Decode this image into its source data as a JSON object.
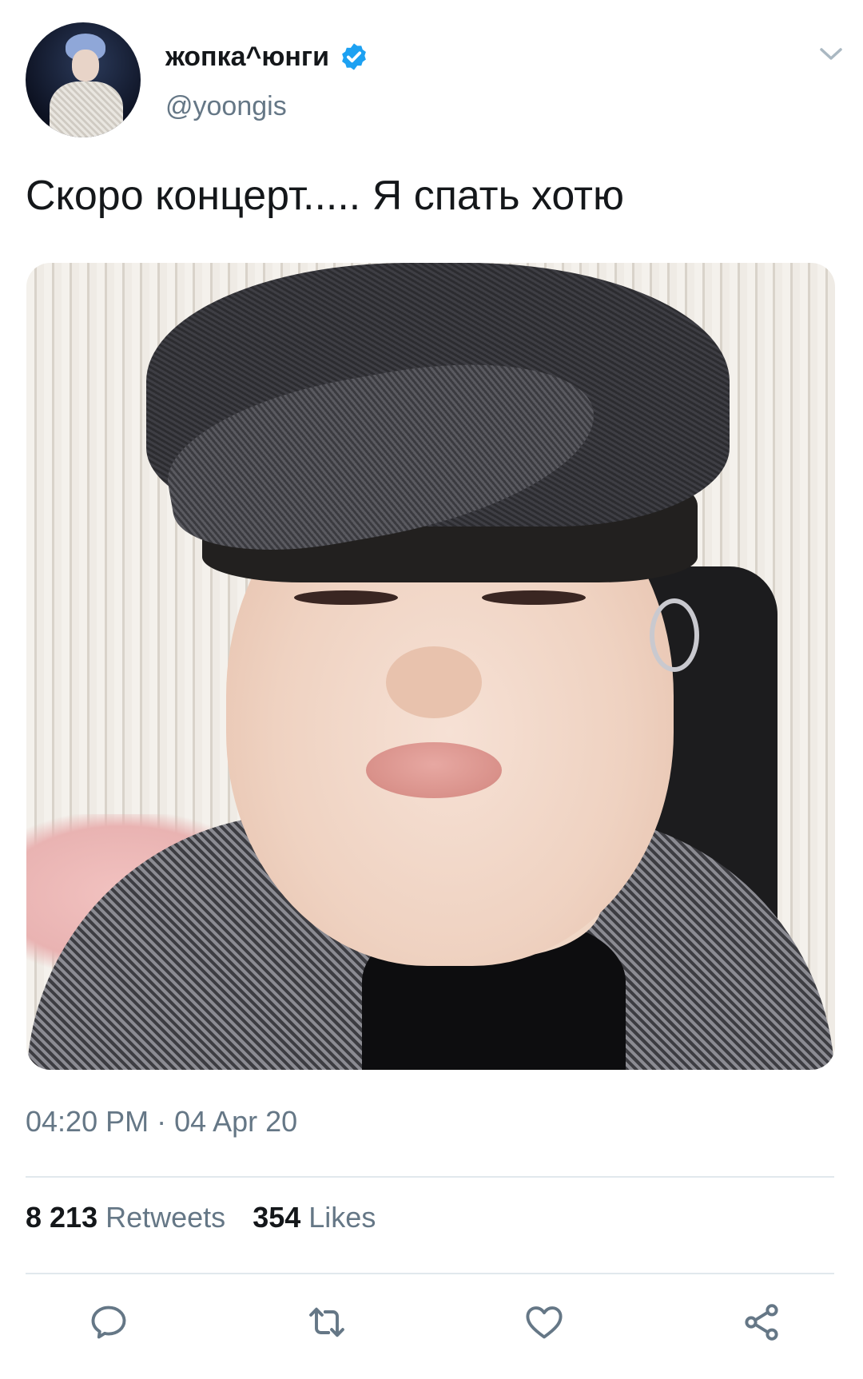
{
  "tweet": {
    "display_name": "жопка^юнги",
    "handle": "@yoongis",
    "verified": true,
    "text": "Скоро концерт..... Я спать хотю",
    "timestamp": "04:20 PM · 04 Apr 20",
    "stats": {
      "retweets_count": "8 213",
      "retweets_label": "Retweets",
      "likes_count": "354",
      "likes_label": "Likes"
    },
    "actions": [
      "reply-icon",
      "retweet-icon",
      "like-icon",
      "share-icon"
    ],
    "colors": {
      "verified": "#1da1f2",
      "secondary_text": "#657786",
      "primary_text": "#14171a",
      "divider": "#e1e8ed"
    }
  }
}
